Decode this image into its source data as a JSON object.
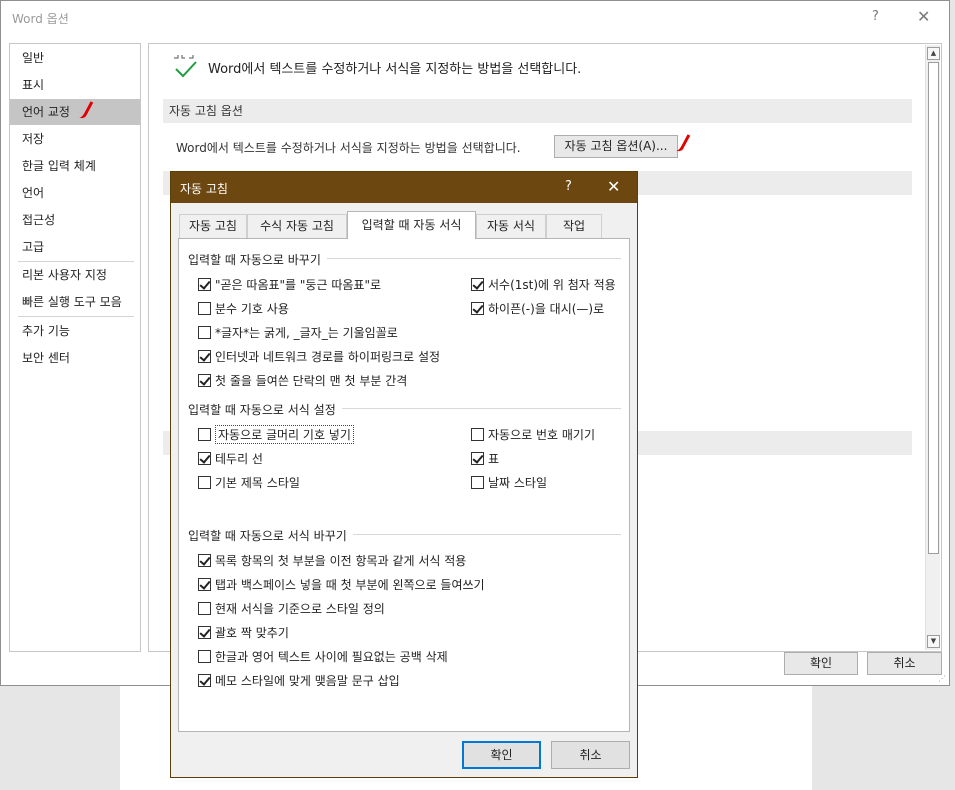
{
  "window": {
    "title": "Word 옵션",
    "help": "?",
    "close": "✕",
    "ok_label": "확인",
    "cancel_label": "취소"
  },
  "nav": {
    "items": [
      {
        "label": "일반"
      },
      {
        "label": "표시"
      },
      {
        "label": "언어 교정",
        "selected": true
      },
      {
        "label": "저장"
      },
      {
        "label": "한글 입력 체계"
      },
      {
        "label": "언어"
      },
      {
        "label": "접근성"
      },
      {
        "label": "고급"
      },
      {
        "label": "리본 사용자 지정"
      },
      {
        "label": "빠른 실행 도구 모음"
      },
      {
        "label": "추가 기능"
      },
      {
        "label": "보안 센터"
      }
    ]
  },
  "content": {
    "header": "Word에서 텍스트를 수정하거나 서식을 지정하는 방법을 선택합니다.",
    "section_title": "자동 고침 옵션",
    "description": "Word에서 텍스트를 수정하거나 서식을 지정하는 방법을 선택합니다.",
    "autocorrect_button": "자동 고침 옵션(A)..."
  },
  "dialog": {
    "title": "자동 고침",
    "help": "?",
    "close": "✕",
    "tabs": [
      {
        "label": "자동 고침"
      },
      {
        "label": "수식 자동 고침"
      },
      {
        "label": "입력할 때 자동 서식",
        "active": true
      },
      {
        "label": "자동 서식"
      },
      {
        "label": "작업"
      }
    ],
    "group1": {
      "title": "입력할 때 자동으로 바꾸기",
      "left": [
        {
          "label": "\"곧은 따옴표\"를 \"둥근 따옴표\"로",
          "checked": true
        },
        {
          "label": "분수 기호 사용",
          "checked": false
        },
        {
          "label": "*글자*는 굵게, _글자_는 기울임꼴로",
          "checked": false
        },
        {
          "label": "인터넷과 네트워크 경로를 하이퍼링크로 설정",
          "checked": true
        },
        {
          "label": "첫 줄을 들여쓴 단락의 맨 첫 부분 간격",
          "checked": true
        }
      ],
      "right": [
        {
          "label": "서수(1st)에 위 첨자 적용",
          "checked": true
        },
        {
          "label": "하이픈(-)을 대시(—)로",
          "checked": true
        }
      ]
    },
    "group2": {
      "title": "입력할 때 자동으로 서식 설정",
      "left": [
        {
          "label": "자동으로 글머리 기호 넣기",
          "checked": false
        },
        {
          "label": "테두리 선",
          "checked": true
        },
        {
          "label": "기본 제목 스타일",
          "checked": false
        }
      ],
      "right": [
        {
          "label": "자동으로 번호 매기기",
          "checked": false
        },
        {
          "label": "표",
          "checked": true
        },
        {
          "label": "날짜 스타일",
          "checked": false
        }
      ]
    },
    "group3": {
      "title": "입력할 때 자동으로 서식 바꾸기",
      "items": [
        {
          "label": "목록 항목의 첫 부분을 이전 항목과 같게 서식 적용",
          "checked": true
        },
        {
          "label": "탭과 백스페이스 넣을 때 첫 부분에 왼쪽으로 들여쓰기",
          "checked": true
        },
        {
          "label": "현재 서식을 기준으로 스타일 정의",
          "checked": false
        },
        {
          "label": "괄호 짝 맞추기",
          "checked": true
        },
        {
          "label": "한글과 영어 텍스트 사이에 필요없는 공백 삭제",
          "checked": false
        },
        {
          "label": "메모 스타일에 맞게 맺음말 문구 삽입",
          "checked": true
        }
      ]
    },
    "ok_label": "확인",
    "cancel_label": "취소"
  }
}
